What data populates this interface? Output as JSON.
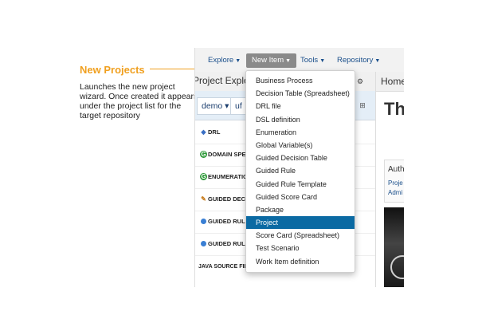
{
  "callout": {
    "title": "New Projects",
    "description": "Launches the new project wizard. Once created it appears under the project list for the target repository"
  },
  "navbar": {
    "items": [
      {
        "label": "Explore"
      },
      {
        "label": "New Item"
      },
      {
        "label": "Tools"
      },
      {
        "label": "Repository"
      }
    ]
  },
  "left_panel": {
    "title": "Project Explorer",
    "selectors": [
      "demo",
      "uf"
    ],
    "rows": [
      {
        "label": "DRL",
        "icon": "drl-icon"
      },
      {
        "label": "DOMAIN SPEC",
        "icon": "green-circle-icon"
      },
      {
        "label": "ENUMERATIO",
        "icon": "green-circle-icon"
      },
      {
        "label": "GUIDED DECI",
        "icon": "pencil-icon"
      },
      {
        "label": "GUIDED RULE",
        "icon": "blue-dot-icon"
      },
      {
        "label": "GUIDED RULE",
        "icon": "blue-dot-icon"
      }
    ],
    "java_row": "JAVA SOURCE FILES"
  },
  "right_panel": {
    "home_label": "Home",
    "big_title": "Th",
    "auth_title": "Auth",
    "auth_links": [
      "Proje",
      "Admi"
    ]
  },
  "menu": {
    "items": [
      "Business Process",
      "Decision Table (Spreadsheet)",
      "DRL file",
      "DSL definition",
      "Enumeration",
      "Global Variable(s)",
      "Guided Decision Table",
      "Guided Rule",
      "Guided Rule Template",
      "Guided Score Card",
      "Package",
      "Project",
      "Score Card (Spreadsheet)",
      "Test Scenario",
      "Work Item definition"
    ],
    "active": "Project"
  },
  "colors": {
    "accent": "#f0a020",
    "menu_active": "#0b6aa3",
    "nav_active": "#8a8a8a"
  }
}
